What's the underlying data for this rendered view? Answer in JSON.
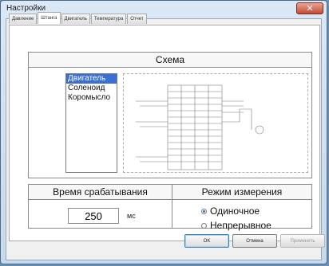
{
  "window": {
    "title": "Настройки",
    "close_glyph": "✕"
  },
  "tabs": [
    {
      "label": "Давление",
      "active": false
    },
    {
      "label": "Штанга",
      "active": true
    },
    {
      "label": "Двигатель",
      "active": false
    },
    {
      "label": "Температура",
      "active": false
    },
    {
      "label": "Отчет",
      "active": false
    }
  ],
  "scheme": {
    "title": "Схема",
    "items": [
      "Двигатель",
      "Соленоид",
      "Коромысло"
    ],
    "selected_index": 0
  },
  "response_time": {
    "title": "Время срабатывания",
    "value": "250",
    "unit": "мс"
  },
  "measure_mode": {
    "title": "Режим измерения",
    "options": [
      {
        "label": "Одиночное",
        "selected": true
      },
      {
        "label": "Непрерывное",
        "selected": false
      }
    ]
  },
  "buttons": {
    "ok": "OK",
    "cancel": "Отмена",
    "apply": "Применить"
  },
  "colors": {
    "accent": "#2a7ad1",
    "selection": "#3a6fd6",
    "close": "#c44a32"
  }
}
